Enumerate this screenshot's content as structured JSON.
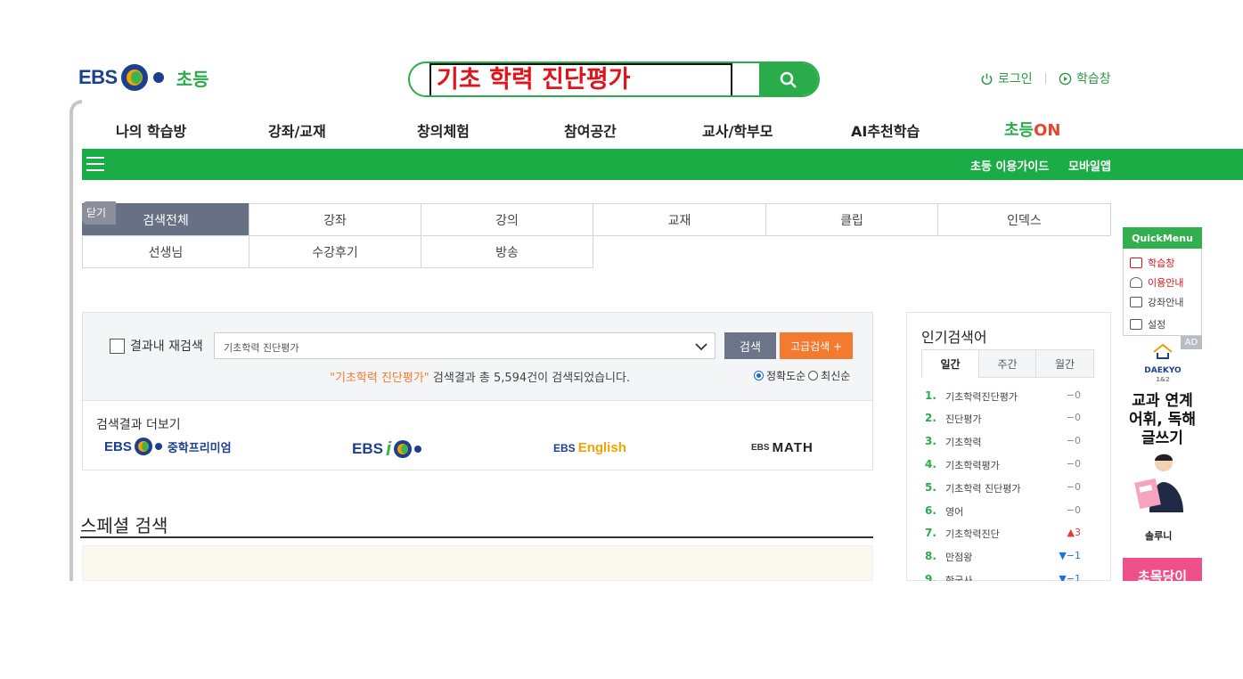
{
  "header": {
    "logo_text": "EBS",
    "logo_sub": "초등",
    "search_value": "기초 학력 진단평가",
    "login": "로그인",
    "study_window": "학습창"
  },
  "gnb": [
    "나의 학습방",
    "강좌/교재",
    "창의체험",
    "참여공간",
    "교사/학부모",
    "AI추천학습"
  ],
  "gnb_on": {
    "left": "초등",
    "right": "ON"
  },
  "greenbar": {
    "guide": "초등 이용가이드",
    "mobile": "모바일앱"
  },
  "close_label": "닫기",
  "tabs": [
    "검색전체",
    "강좌",
    "강의",
    "교재",
    "클립",
    "인덱스",
    "선생님",
    "수강후기",
    "방송"
  ],
  "research": {
    "checkbox_label": "결과내 재검색",
    "select_value": "기초학력 진단평가",
    "search_btn": "검색",
    "adv_btn": "고급검색 +",
    "query_quoted": "\"기초학력 진단평가\"",
    "result_text": " 검색결과 총 5,594건이 검색되었습니다.",
    "sort_accuracy": "정확도순",
    "sort_recent": "최신순"
  },
  "more": {
    "title": "검색결과 더보기",
    "brands": [
      "EBS",
      "중학프리미엄",
      "EBS",
      "i",
      "EBS",
      "English",
      "EBS",
      "MATH"
    ]
  },
  "special_title": "스페셜 검색",
  "popular": {
    "title": "인기검색어",
    "tabs": [
      "일간",
      "주간",
      "월간"
    ],
    "rows": [
      {
        "n": "1.",
        "k": "기초학력진단평가",
        "c": "−0",
        "t": ""
      },
      {
        "n": "2.",
        "k": "진단평가",
        "c": "−0",
        "t": ""
      },
      {
        "n": "3.",
        "k": "기초학력",
        "c": "−0",
        "t": ""
      },
      {
        "n": "4.",
        "k": "기초학력평가",
        "c": "−0",
        "t": ""
      },
      {
        "n": "5.",
        "k": "기초학력 진단평가",
        "c": "−0",
        "t": ""
      },
      {
        "n": "6.",
        "k": "영어",
        "c": "−0",
        "t": ""
      },
      {
        "n": "7.",
        "k": "기초학력진단",
        "c": "▲3",
        "t": "up"
      },
      {
        "n": "8.",
        "k": "만점왕",
        "c": "▼−1",
        "t": "down"
      },
      {
        "n": "9.",
        "k": "한국사",
        "c": "▼−1",
        "t": "down"
      }
    ]
  },
  "quick_menu": {
    "title": "QuickMenu",
    "items": [
      "학습창",
      "이용안내",
      "강좌안내",
      "설정"
    ]
  },
  "ad": {
    "tag": "AD",
    "brand": "DAEKYO",
    "brand_num": "1&2",
    "headline": "교과 연계 어휘, 독해 글쓰기",
    "product": "솔루니",
    "pink": "초목당이"
  }
}
